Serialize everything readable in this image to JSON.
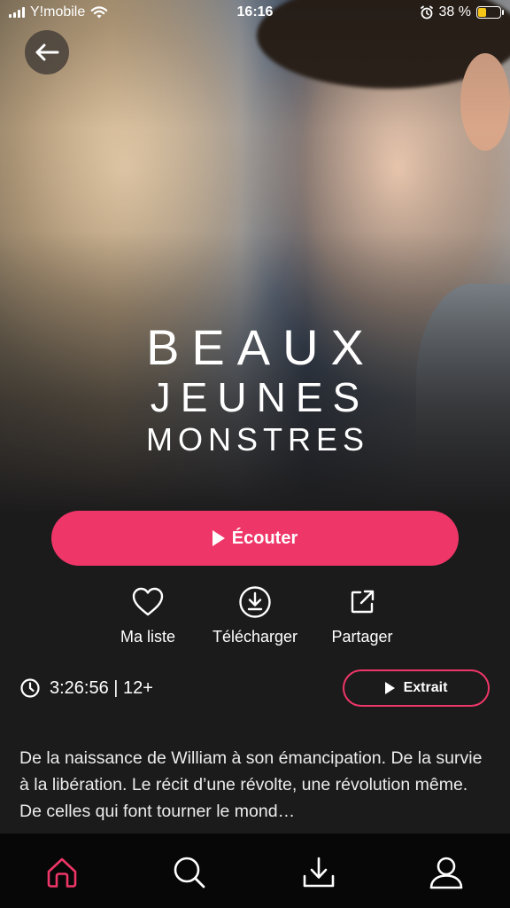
{
  "status_bar": {
    "carrier": "Y!mobile",
    "time": "16:16",
    "battery_percent": "38 %",
    "battery_level": 0.38
  },
  "hero": {
    "title_line1": "BEAUX",
    "title_line2": "JEUNES",
    "title_line3": "MONSTRES"
  },
  "actions": {
    "play_label": "Écouter",
    "my_list_label": "Ma liste",
    "download_label": "Télécharger",
    "share_label": "Partager"
  },
  "meta": {
    "duration_rating": "3:26:56 | 12+",
    "extract_label": "Extrait"
  },
  "description": "De la naissance de William à son émancipation. De la survie à la libération. Le récit d’une révolte, une révolution même. De celles qui font tourner le mond…",
  "tabbar": {
    "items": [
      "home-icon",
      "search-icon",
      "download-icon",
      "profile-icon"
    ],
    "active": "home-icon"
  },
  "colors": {
    "accent": "#ef3668",
    "background": "#1c1b1c",
    "tabbar": "#070707"
  }
}
